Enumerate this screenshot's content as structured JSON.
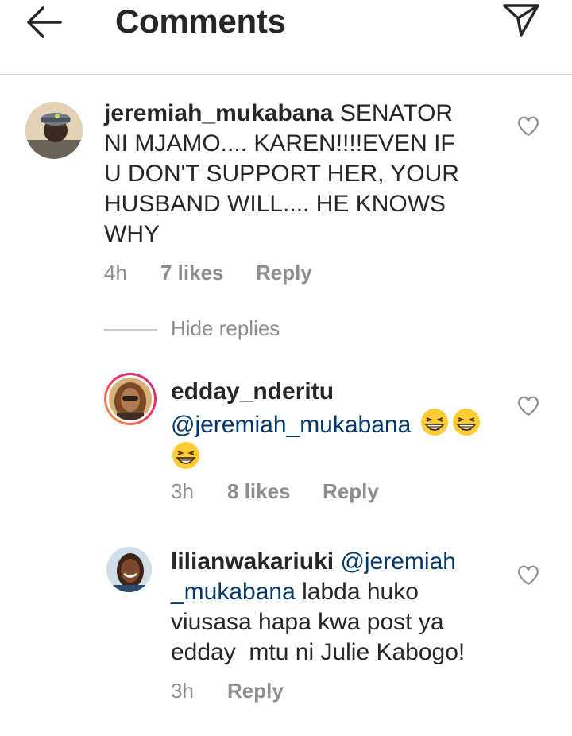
{
  "header": {
    "title": "Comments",
    "back_icon": "arrow-left-icon",
    "send_icon": "paper-plane-icon"
  },
  "comments": [
    {
      "username": "jeremiah_mukabana",
      "lines": [
        "SENATOR",
        "NI MJAMO.... KAREN!!!!EVEN IF",
        "U DON'T SUPPORT HER, YOUR",
        "HUSBAND WILL.... HE KNOWS",
        "WHY"
      ],
      "time": "4h",
      "likes": "7 likes",
      "reply_label": "Reply"
    }
  ],
  "replies_toggle": "Hide replies",
  "replies": [
    {
      "username": "edday_nderitu",
      "mention": "@jeremiah_mukabana",
      "emoji": "grinning-squinting-face",
      "time": "3h",
      "likes": "8 likes",
      "reply_label": "Reply"
    },
    {
      "username": "lilianwakariuki",
      "mention_part1": "@jeremiah",
      "mention_part2": "_mukabana",
      "line2_rest": " labda huko",
      "line3": "viusasa hapa kwa post ya",
      "line4": "edday  mtu ni Julie Kabogo!",
      "time": "3h",
      "reply_label": "Reply"
    }
  ],
  "colors": {
    "text": "#262626",
    "secondary": "#8e8e8e",
    "mention": "#00376b",
    "divider": "#dbdbdb"
  }
}
